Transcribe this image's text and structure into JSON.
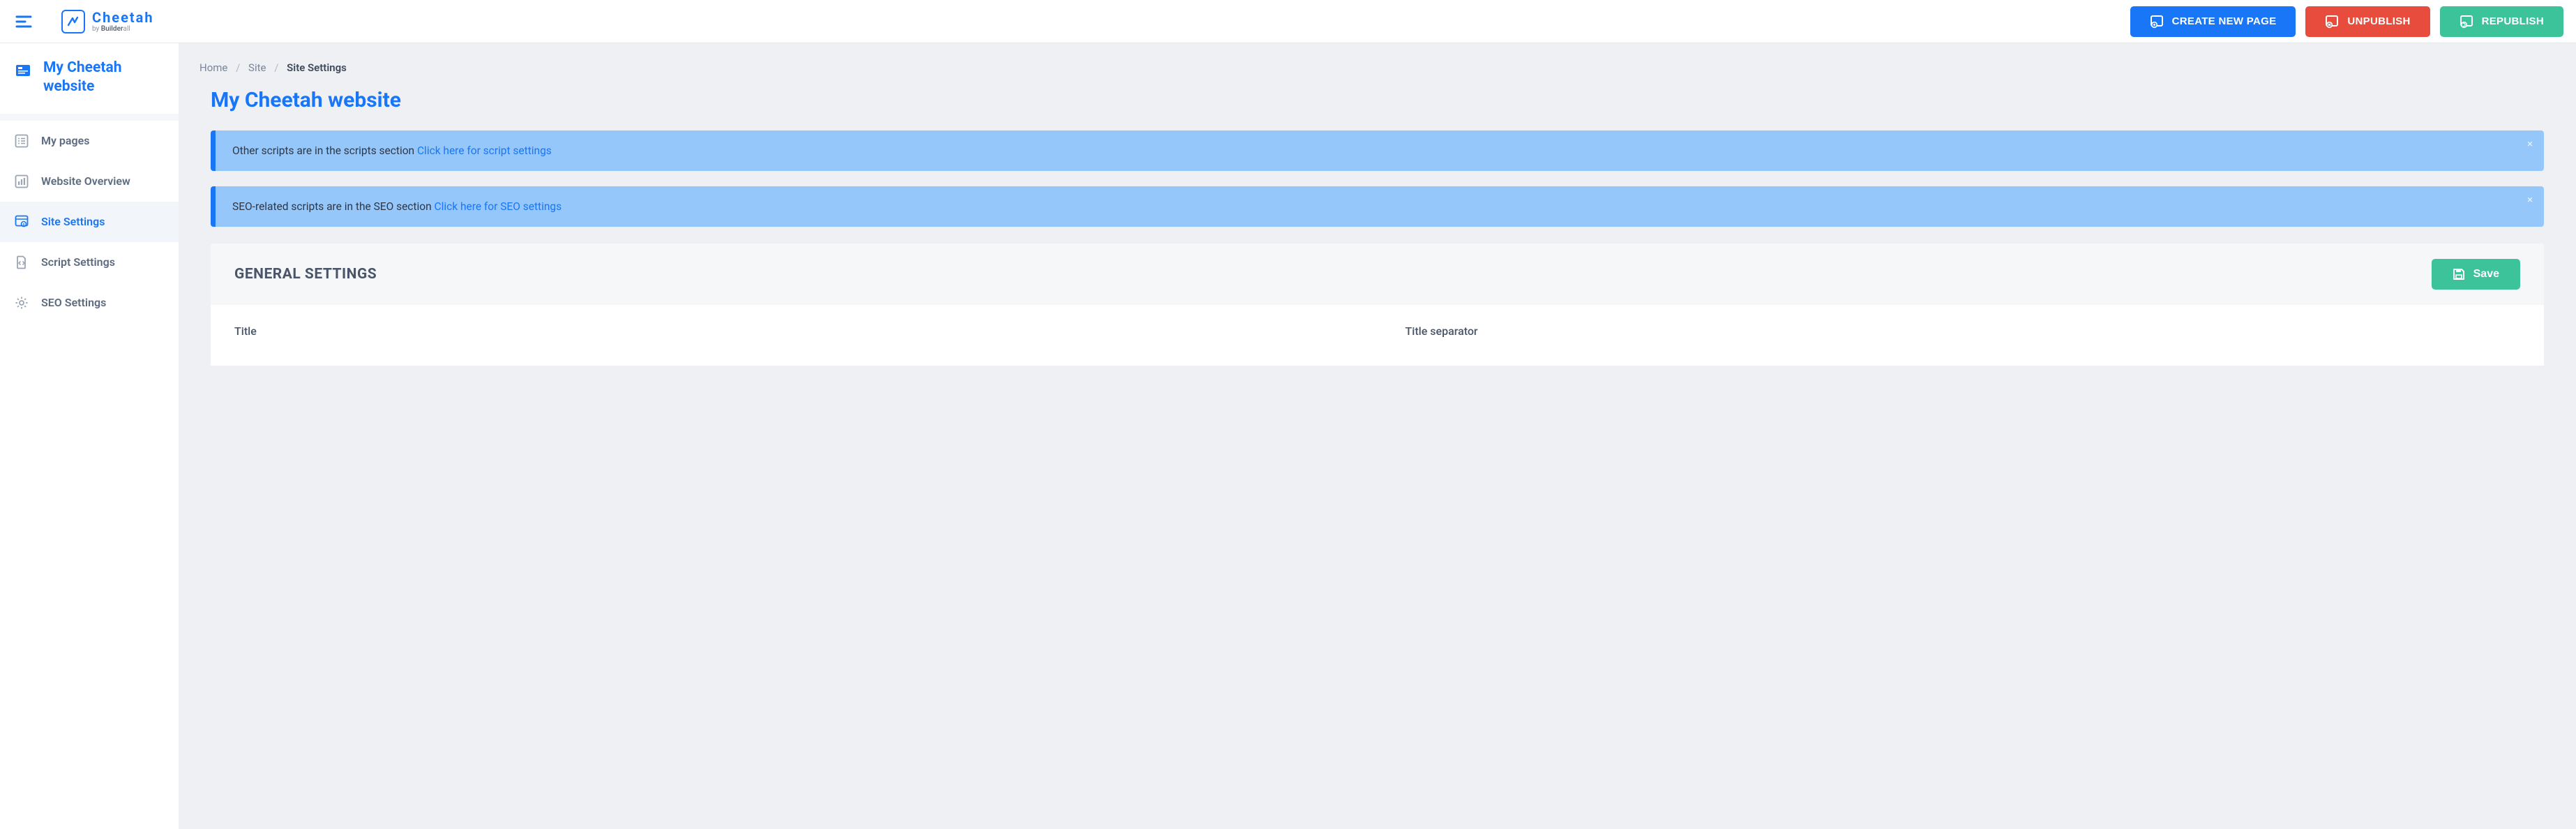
{
  "brand": {
    "name": "Cheetah",
    "byline_prefix": "by ",
    "byline_strong": "Builder",
    "byline_suffix": "all"
  },
  "header_actions": {
    "create_page": "CREATE NEW PAGE",
    "unpublish": "UNPUBLISH",
    "republish": "REPUBLISH"
  },
  "sidebar": {
    "site_title": "My Cheetah website",
    "items": [
      {
        "label": "My pages"
      },
      {
        "label": "Website Overview"
      },
      {
        "label": "Site Settings"
      },
      {
        "label": "Script Settings"
      },
      {
        "label": "SEO Settings"
      }
    ]
  },
  "breadcrumb": {
    "home": "Home",
    "site": "Site",
    "current": "Site Settings"
  },
  "page_title": "My Cheetah website",
  "alerts": {
    "scripts_text": "Other scripts are in the scripts section ",
    "scripts_link": "Click here for script settings",
    "seo_text": "SEO-related scripts are in the SEO section ",
    "seo_link": "Click here for SEO settings"
  },
  "panel": {
    "title": "GENERAL SETTINGS",
    "save": "Save",
    "field_title": "Title",
    "field_separator": "Title separator"
  }
}
